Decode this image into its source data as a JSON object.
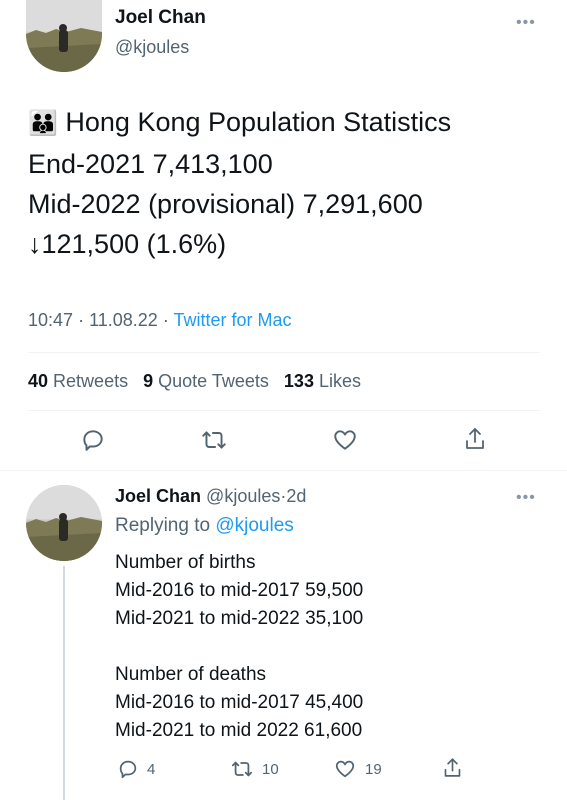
{
  "tweet": {
    "author_name": "Joel Chan",
    "handle": "@kjoules",
    "emoji": "👪",
    "lines": [
      "Hong Kong Population Statistics",
      "End-2021 7,413,100",
      "Mid-2022 (provisional) 7,291,600",
      "↓121,500 (1.6%)"
    ],
    "time": "10:47",
    "date": "11.08.22",
    "source": "Twitter for Mac",
    "stats": {
      "retweets_count": "40",
      "retweets_label": "Retweets",
      "quotes_count": "9",
      "quotes_label": "Quote Tweets",
      "likes_count": "133",
      "likes_label": "Likes"
    }
  },
  "reply": {
    "author_name": "Joel Chan",
    "handle": "@kjoules",
    "age": "2d",
    "replying_to_label": "Replying to",
    "replying_to_handle": "@kjoules",
    "lines": [
      "Number of births",
      "Mid-2016 to mid-2017 59,500",
      "Mid-2021 to mid-2022 35,100",
      "",
      "Number of deaths",
      "Mid-2016 to mid-2017 45,400",
      "Mid-2021 to mid 2022 61,600"
    ],
    "actions": {
      "reply_count": "4",
      "retweet_count": "10",
      "like_count": "19"
    }
  },
  "separators": {
    "dot": "·"
  },
  "icons": {
    "more": "more-horizontal-icon",
    "reply": "reply-icon",
    "retweet": "retweet-icon",
    "like": "heart-icon",
    "share": "share-icon"
  }
}
